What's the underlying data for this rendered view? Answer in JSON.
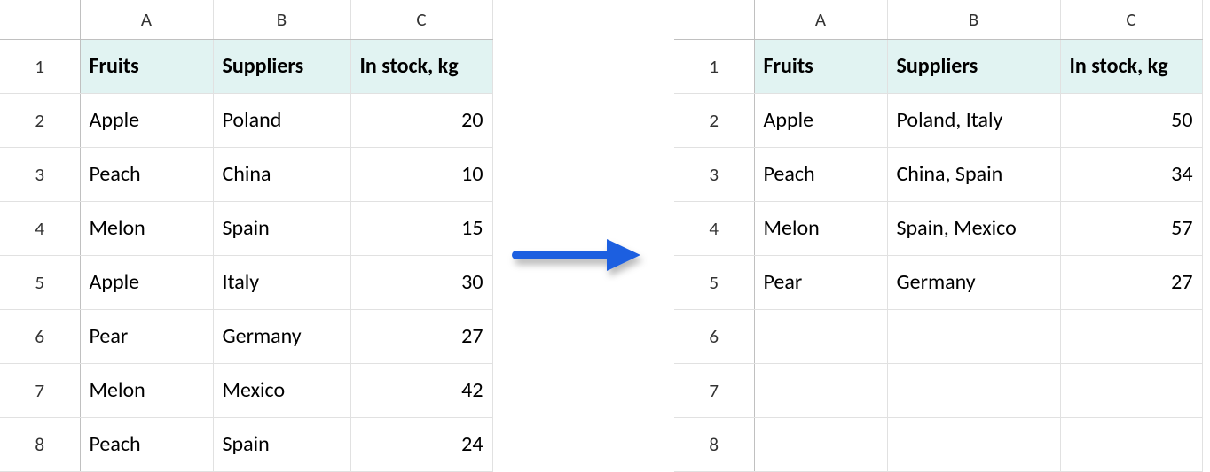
{
  "columns": [
    "A",
    "B",
    "C"
  ],
  "row_numbers": [
    "1",
    "2",
    "3",
    "4",
    "5",
    "6",
    "7",
    "8"
  ],
  "headers": {
    "A": "Fruits",
    "B": "Suppliers",
    "C": "In stock, kg"
  },
  "left_table": {
    "rows": [
      {
        "A": "Apple",
        "B": "Poland",
        "C": "20"
      },
      {
        "A": "Peach",
        "B": "China",
        "C": "10"
      },
      {
        "A": "Melon",
        "B": "Spain",
        "C": "15"
      },
      {
        "A": "Apple",
        "B": "Italy",
        "C": "30"
      },
      {
        "A": "Pear",
        "B": "Germany",
        "C": "27"
      },
      {
        "A": "Melon",
        "B": "Mexico",
        "C": "42"
      },
      {
        "A": "Peach",
        "B": "Spain",
        "C": "24"
      }
    ]
  },
  "right_table": {
    "rows": [
      {
        "A": "Apple",
        "B": "Poland, Italy",
        "C": "50"
      },
      {
        "A": "Peach",
        "B": "China, Spain",
        "C": "34"
      },
      {
        "A": "Melon",
        "B": "Spain, Mexico",
        "C": "57"
      },
      {
        "A": "Pear",
        "B": "Germany",
        "C": "27"
      },
      {
        "A": "",
        "B": "",
        "C": ""
      },
      {
        "A": "",
        "B": "",
        "C": ""
      },
      {
        "A": "",
        "B": "",
        "C": ""
      }
    ]
  },
  "chart_data": {
    "type": "table",
    "description": "Before/after comparison of spreadsheet data consolidation: duplicate Fruits rows are merged, Suppliers concatenated with commas, In stock kg summed.",
    "before": {
      "columns": [
        "Fruits",
        "Suppliers",
        "In stock, kg"
      ],
      "rows": [
        [
          "Apple",
          "Poland",
          20
        ],
        [
          "Peach",
          "China",
          10
        ],
        [
          "Melon",
          "Spain",
          15
        ],
        [
          "Apple",
          "Italy",
          30
        ],
        [
          "Pear",
          "Germany",
          27
        ],
        [
          "Melon",
          "Mexico",
          42
        ],
        [
          "Peach",
          "Spain",
          24
        ]
      ]
    },
    "after": {
      "columns": [
        "Fruits",
        "Suppliers",
        "In stock, kg"
      ],
      "rows": [
        [
          "Apple",
          "Poland, Italy",
          50
        ],
        [
          "Peach",
          "China, Spain",
          34
        ],
        [
          "Melon",
          "Spain, Mexico",
          57
        ],
        [
          "Pear",
          "Germany",
          27
        ]
      ]
    }
  }
}
